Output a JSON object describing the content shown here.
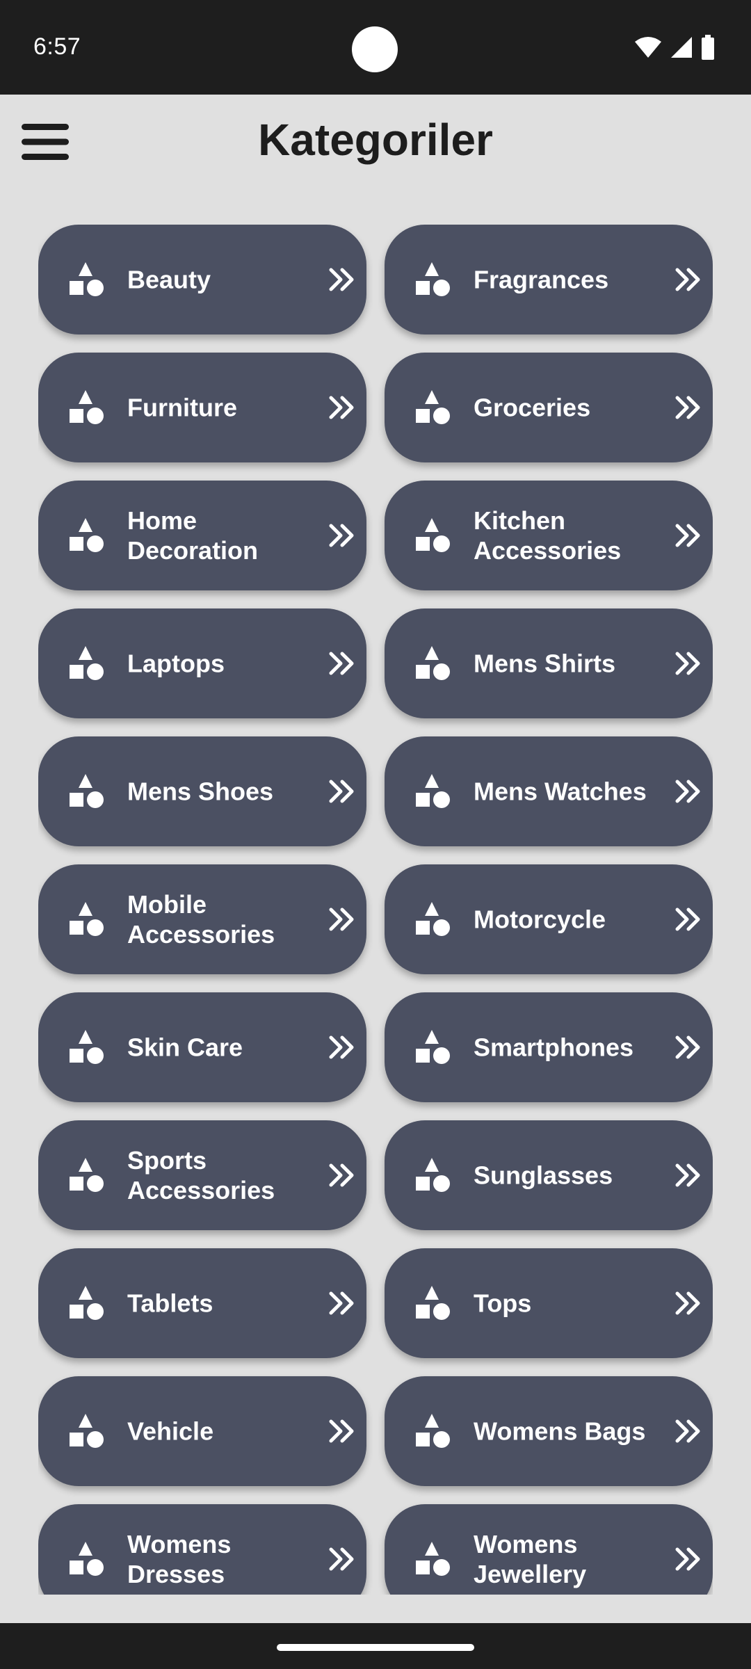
{
  "status_bar": {
    "time": "6:57",
    "icons": [
      "wifi-icon",
      "cellular-signal-icon",
      "battery-icon"
    ]
  },
  "header": {
    "title": "Kategoriler",
    "menu_icon": "hamburger-menu-icon"
  },
  "categories": [
    {
      "label": "Beauty"
    },
    {
      "label": "Fragrances"
    },
    {
      "label": "Furniture"
    },
    {
      "label": "Groceries"
    },
    {
      "label": "Home Decoration"
    },
    {
      "label": "Kitchen Accessories"
    },
    {
      "label": "Laptops"
    },
    {
      "label": "Mens Shirts"
    },
    {
      "label": "Mens Shoes"
    },
    {
      "label": "Mens Watches"
    },
    {
      "label": "Mobile Accessories"
    },
    {
      "label": "Motorcycle"
    },
    {
      "label": "Skin Care"
    },
    {
      "label": "Smartphones"
    },
    {
      "label": "Sports Accessories"
    },
    {
      "label": "Sunglasses"
    },
    {
      "label": "Tablets"
    },
    {
      "label": "Tops"
    },
    {
      "label": "Vehicle"
    },
    {
      "label": "Womens Bags"
    },
    {
      "label": "Womens Dresses"
    },
    {
      "label": "Womens Jewellery"
    }
  ],
  "category_icon": "shapes-icon",
  "chevron_icon": "double-chevron-right-icon",
  "colors": {
    "background": "#e0e0e0",
    "button": "#4b5062",
    "button_text": "#ffffff",
    "title": "#1d1d1d",
    "system_bars": "#1e1e1e"
  }
}
